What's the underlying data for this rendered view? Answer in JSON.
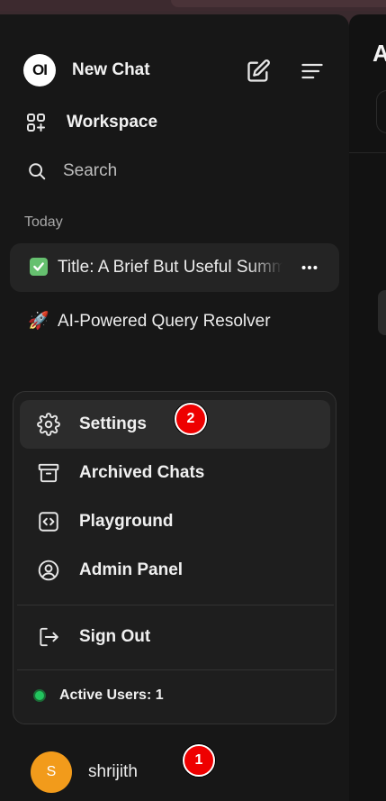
{
  "sidebar": {
    "logo_text": "OI",
    "new_chat_label": "New Chat",
    "workspace_label": "Workspace",
    "search_label": "Search",
    "section_today": "Today",
    "chats": [
      {
        "emoji": "✅",
        "title": "Title: A Brief But Useful Summary",
        "active": true
      },
      {
        "emoji": "🚀",
        "title": "AI-Powered Query Resolver",
        "active": false
      }
    ]
  },
  "main": {
    "title_fragment": "A"
  },
  "user_menu": {
    "items": [
      {
        "label": "Settings",
        "icon": "gear-icon"
      },
      {
        "label": "Archived Chats",
        "icon": "archive-icon"
      },
      {
        "label": "Playground",
        "icon": "code-icon"
      },
      {
        "label": "Admin Panel",
        "icon": "user-circle-icon"
      }
    ],
    "sign_out_label": "Sign Out",
    "active_users_label": "Active Users: 1"
  },
  "user": {
    "avatar_initial": "S",
    "name": "shrijith"
  },
  "markers": {
    "one": "1",
    "two": "2"
  },
  "colors": {
    "sidebar_bg": "#171717",
    "avatar": "#f29b1b",
    "online": "#22c55e",
    "marker": "#e00000"
  }
}
